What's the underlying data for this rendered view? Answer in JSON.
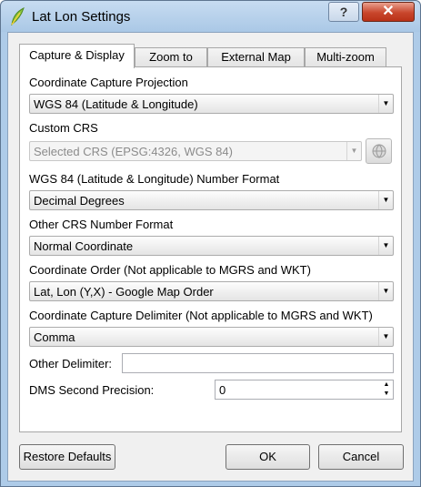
{
  "window": {
    "title": "Lat Lon Settings",
    "help_label": "?",
    "close_label": "✕"
  },
  "tabs": [
    {
      "label": "Capture & Display",
      "active": true
    },
    {
      "label": "Zoom to",
      "active": false
    },
    {
      "label": "External Map",
      "active": false
    },
    {
      "label": "Multi-zoom",
      "active": false
    }
  ],
  "capture": {
    "projection_label": "Coordinate Capture Projection",
    "projection_value": "WGS 84 (Latitude & Longitude)",
    "custom_crs_label": "Custom CRS",
    "custom_crs_value": "Selected CRS (EPSG:4326, WGS 84)",
    "wgs_format_label": "WGS 84 (Latitude & Longitude) Number Format",
    "wgs_format_value": "Decimal Degrees",
    "other_format_label": "Other CRS Number Format",
    "other_format_value": "Normal Coordinate",
    "order_label": "Coordinate Order (Not applicable to MGRS and WKT)",
    "order_value": "Lat, Lon (Y,X) - Google Map Order",
    "delimiter_label": "Coordinate Capture Delimiter (Not applicable to MGRS and WKT)",
    "delimiter_value": "Comma",
    "other_delimiter_label": "Other Delimiter:",
    "other_delimiter_value": "",
    "dms_precision_label": "DMS Second Precision:",
    "dms_precision_value": "0"
  },
  "buttons": {
    "restore": "Restore Defaults",
    "ok": "OK",
    "cancel": "Cancel"
  },
  "icons": {
    "app": "qgis-leaf-icon",
    "crs_select": "globe-icon",
    "dropdown": "chevron-down-icon"
  }
}
